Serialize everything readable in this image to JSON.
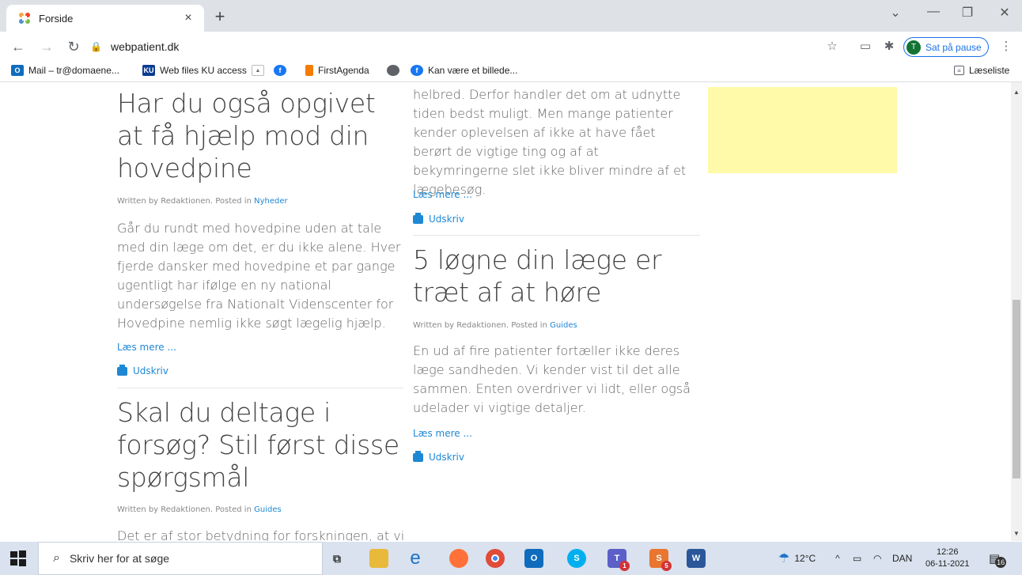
{
  "browser": {
    "tab_title": "Forside",
    "tab_close": "×",
    "new_tab": "+",
    "url": "webpatient.dk",
    "profile_initial": "T",
    "profile_label": "Sat på pause",
    "bookmarks": [
      {
        "label": "Mail – tr@domaene...",
        "color": "#0f6cbd",
        "glyph": "O"
      },
      {
        "label": "Web files KU access",
        "color": "#0a3d91",
        "glyph": "KU"
      },
      {
        "label": "",
        "color": "#6d6d6d",
        "glyph": ""
      },
      {
        "label": "",
        "color": "#1877f2",
        "glyph": "f"
      },
      {
        "label": "FirstAgenda",
        "color": "#f57c00",
        "glyph": ""
      },
      {
        "label": "",
        "color": "#5f6368",
        "glyph": ""
      },
      {
        "label": "Kan være et billede...",
        "color": "#1877f2",
        "glyph": "f"
      }
    ],
    "reading_list": "Læseliste"
  },
  "page": {
    "left": {
      "article1": {
        "title": "Har du også opgivet at få hjælp mod din hovedpine",
        "meta_prefix": "Written by Redaktionen. Posted in ",
        "category": "Nyheder",
        "body": "Går du rundt med hovedpine uden at tale med din læge om det, er du ikke alene. Hver fjerde dansker med hovedpine et par gange ugentligt har ifølge en ny national undersøgelse fra Nationalt Videnscenter for Hovedpine nemlig ikke søgt lægelig hjælp.",
        "read_more": "Læs mere ...",
        "print": "Udskriv"
      },
      "article2": {
        "title": "Skal du deltage i forsøg? Stil først disse spørgsmål",
        "meta_prefix": "Written by Redaktionen. Posted in ",
        "category": "Guides",
        "body": "Det er af stor betydning for forskningen, at vi"
      }
    },
    "middle": {
      "article0": {
        "body": "helbred. Derfor handler det om at udnytte tiden bedst muligt.  Men mange patienter kender oplevelsen af ikke at have fået berørt de vigtige ting og af at bekymringerne slet ikke bliver mindre af et lægebesøg.",
        "read_more": "Læs mere ...",
        "print": "Udskriv"
      },
      "article1": {
        "title": "5 løgne din læge er træt af at høre",
        "meta_prefix": "Written by Redaktionen. Posted in ",
        "category": "Guides",
        "body": "En ud af fire patienter fortæller ikke deres læge sandheden. Vi kender vist til det alle sammen. Enten overdriver vi lidt, eller også udelader vi vigtige detaljer.",
        "read_more": "Læs mere ...",
        "print": "Udskriv"
      }
    }
  },
  "taskbar": {
    "search_placeholder": "Skriv her for at søge",
    "weather": "12°C",
    "language": "DAN",
    "time": "12:26",
    "date": "06-11-2021",
    "notification_count": "16",
    "teams_badge": "1",
    "skype_badge": "5"
  }
}
